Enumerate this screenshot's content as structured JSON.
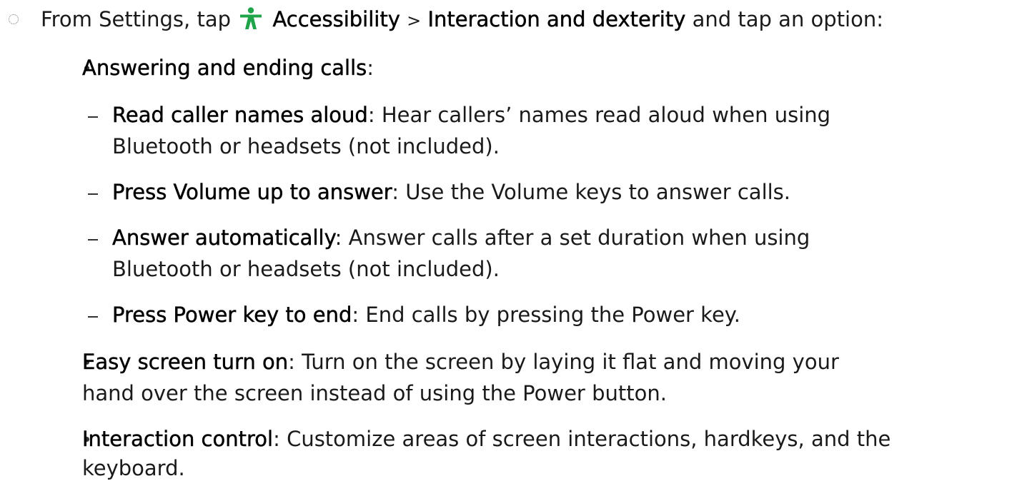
{
  "step": {
    "prefix": "From Settings, tap",
    "accessibility": "Accessibility",
    "separator": ">",
    "interaction": "Interaction and dexterity",
    "suffix": "and tap an option:",
    "icon": "accessibility-icon",
    "icon_color": "#1fa44a"
  },
  "items": {
    "answering": {
      "title": "Answering and ending calls",
      "colon": ":"
    },
    "read_caller": {
      "title": "Read caller names aloud",
      "desc": ": Hear callers’ names read aloud when using",
      "desc2": "Bluetooth or headsets (not included)."
    },
    "volume_up": {
      "title": "Press Volume up to answer",
      "desc": ": Use the Volume keys to answer calls."
    },
    "answer_auto": {
      "title": "Answer automatically",
      "desc": ": Answer calls after a set duration when using",
      "desc2": "Bluetooth or headsets (not included)."
    },
    "power_end": {
      "title": "Press Power key to end",
      "desc": ": End calls by pressing the Power key."
    },
    "easy_screen": {
      "title": "Easy screen turn on",
      "desc": ": Turn on the screen by laying it flat and moving your",
      "desc2": "hand over the screen instead of using the Power button."
    },
    "interaction_control": {
      "title": "Interaction control",
      "desc": ": Customize areas of screen interactions, hardkeys, and the",
      "desc2": "keyboard."
    }
  }
}
